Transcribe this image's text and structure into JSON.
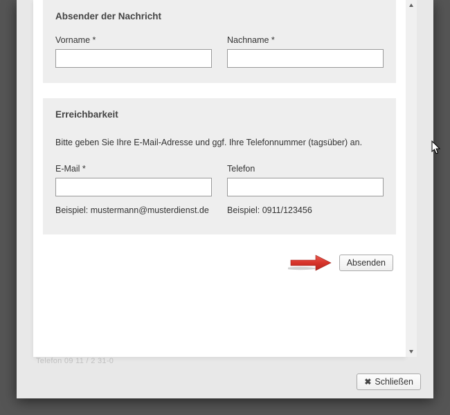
{
  "sections": {
    "sender": {
      "title": "Absender der Nachricht",
      "firstname_label": "Vorname *",
      "lastname_label": "Nachname *"
    },
    "contact": {
      "title": "Erreichbarkeit",
      "description": "Bitte geben Sie Ihre E-Mail-Adresse und ggf. Ihre Telefonnummer (tagsüber) an.",
      "email_label": "E-Mail *",
      "email_hint": "Beispiel: mustermann@musterdienst.de",
      "phone_label": "Telefon",
      "phone_hint": "Beispiel: 0911/123456"
    }
  },
  "buttons": {
    "submit": "Absenden",
    "close": "Schließen"
  },
  "under_text": "Telefon 09 11 / 2 31-0",
  "colors": {
    "arrow": "#d7342b"
  }
}
